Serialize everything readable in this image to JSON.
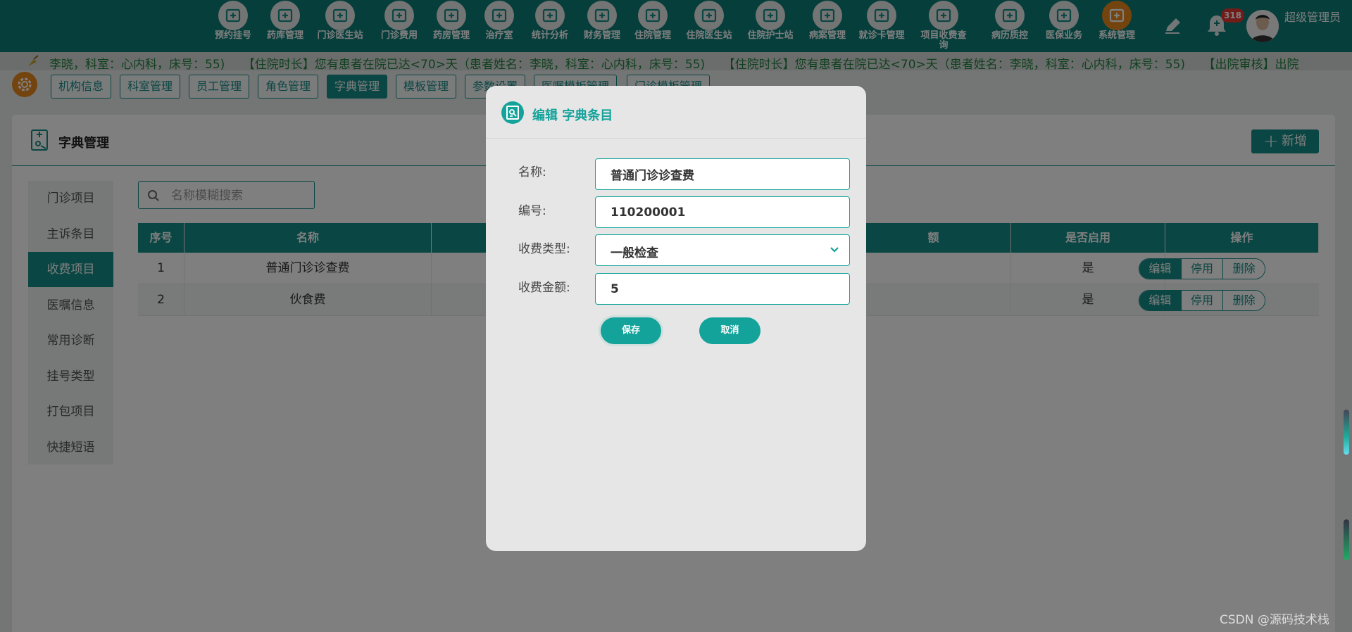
{
  "nav": {
    "items": [
      {
        "label": "预约挂号",
        "icon": "calendar-plus-icon"
      },
      {
        "label": "药库管理",
        "icon": "warehouse-icon"
      },
      {
        "label": "门诊医生站",
        "icon": "doctor-icon"
      },
      {
        "label": "门诊费用",
        "icon": "yen-icon"
      },
      {
        "label": "药房管理",
        "icon": "pill-icon"
      },
      {
        "label": "治疗室",
        "icon": "nurse-icon"
      },
      {
        "label": "统计分析",
        "icon": "bar-chart-icon"
      },
      {
        "label": "财务管理",
        "icon": "gear-money-icon"
      },
      {
        "label": "住院管理",
        "icon": "bed-icon"
      },
      {
        "label": "住院医生站",
        "icon": "id-card-icon"
      },
      {
        "label": "住院护士站",
        "icon": "nurse-station-icon"
      },
      {
        "label": "病案管理",
        "icon": "folder-icon"
      },
      {
        "label": "就诊卡管理",
        "icon": "card-icon"
      },
      {
        "label": "项目收费查询",
        "icon": "receipt-icon"
      },
      {
        "label": "病历质控",
        "icon": "file-check-icon"
      },
      {
        "label": "医保业务",
        "icon": "insurance-icon"
      },
      {
        "label": "系统管理",
        "icon": "system-gear-icon"
      }
    ],
    "active_index": 16
  },
  "header": {
    "notification_count": "318",
    "user_name": "超级管理员"
  },
  "marquee": {
    "text": "李晓，科室：心内科，床号：55)　　【住院时长】您有患者在院已达<70>天（患者姓名：李晓，科室：心内科，床号：55)　　【住院时长】您有患者在院已达<70>天（患者姓名：李晓，科室：心内科，床号：55)　　【出院审核】出院"
  },
  "subtabs": [
    {
      "label": "机构信息"
    },
    {
      "label": "科室管理"
    },
    {
      "label": "员工管理"
    },
    {
      "label": "角色管理"
    },
    {
      "label": "字典管理",
      "active": true
    },
    {
      "label": "模板管理"
    },
    {
      "label": "参数设置"
    },
    {
      "label": "医嘱模板管理"
    },
    {
      "label": "门诊模板管理"
    }
  ],
  "panel": {
    "title": "字典管理",
    "add_label": "新增"
  },
  "left_menu": [
    {
      "label": "门诊项目"
    },
    {
      "label": "主诉条目"
    },
    {
      "label": "收费项目",
      "active": true
    },
    {
      "label": "医嘱信息"
    },
    {
      "label": "常用诊断"
    },
    {
      "label": "挂号类型"
    },
    {
      "label": "打包项目"
    },
    {
      "label": "快捷短语"
    }
  ],
  "search": {
    "placeholder": "名称模糊搜索",
    "value": ""
  },
  "table": {
    "headers": [
      "序号",
      "名称",
      "",
      "",
      "",
      "额",
      "是否启用",
      "操作"
    ],
    "rows": [
      {
        "index": "1",
        "name": "普通门诊诊查费",
        "enabled": "是"
      },
      {
        "index": "2",
        "name": "伙食费",
        "enabled": "是"
      }
    ],
    "actions": [
      "编辑",
      "停用",
      "删除"
    ]
  },
  "modal": {
    "title": "编辑 字典条目",
    "fields": {
      "name_label": "名称:",
      "name_value": "普通门诊诊查费",
      "code_label": "编号:",
      "code_value": "110200001",
      "type_label": "收费类型:",
      "type_value": "一般检查",
      "amount_label": "收费金额:",
      "amount_value": "5"
    },
    "save_label": "保存",
    "cancel_label": "取消"
  },
  "watermark": "CSDN @源码技术栈",
  "colors": {
    "brand": "#148d87",
    "topbar": "#0c7d77",
    "modal_accent": "#13a39b",
    "active_nav": "#e8891f",
    "badge": "#e53935"
  }
}
